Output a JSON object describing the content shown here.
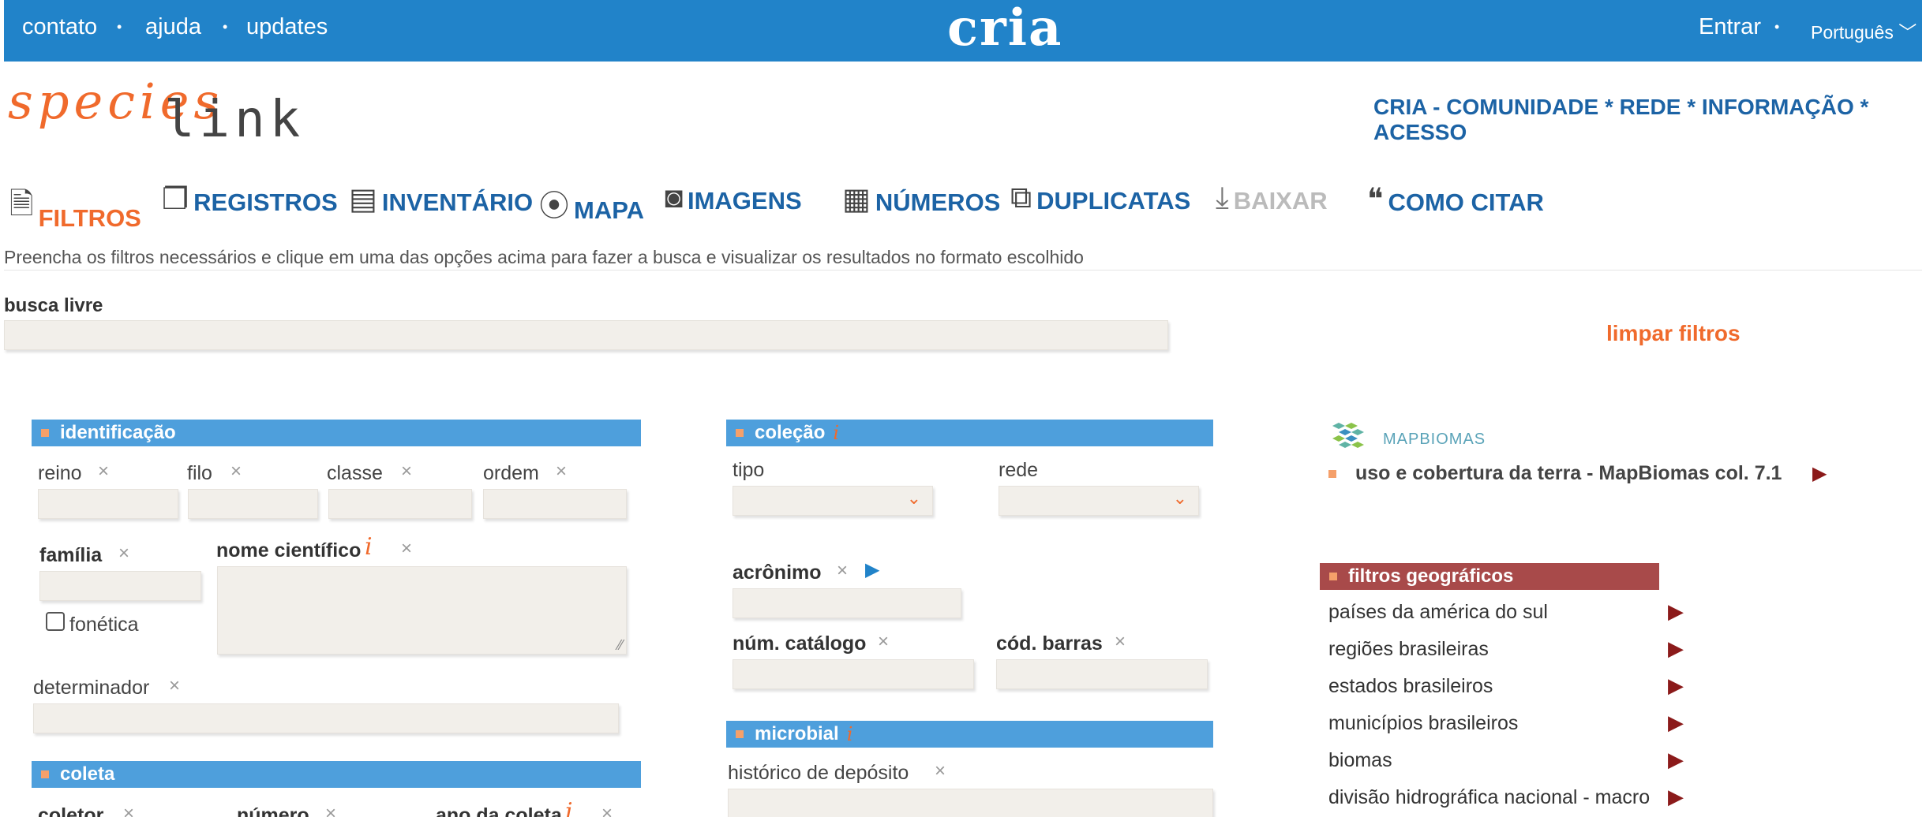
{
  "topbar": {
    "links": [
      "contato",
      "ajuda",
      "updates"
    ],
    "brand": "cria",
    "login": "Entrar",
    "language": "Português"
  },
  "logo": {
    "species": "species",
    "link": "link"
  },
  "tagline": "CRIA - COMUNIDADE * REDE * INFORMAÇÃO * ACESSO",
  "nav": {
    "filtros": "FILTROS",
    "registros": "REGISTROS",
    "inventario": "INVENTÁRIO",
    "mapa": "MAPA",
    "imagens": "IMAGENS",
    "numeros": "NÚMEROS",
    "duplicatas": "DUPLICATAS",
    "baixar": "BAIXAR",
    "como_citar": "COMO CITAR"
  },
  "hint": "Preencha os filtros necessários e clique em uma das opções acima para fazer a busca e visualizar os resultados no formato escolhido",
  "busca_livre": "busca livre",
  "limpar": "limpar filtros",
  "identificacao": {
    "title": "identificação",
    "reino": "reino",
    "filo": "filo",
    "classe": "classe",
    "ordem": "ordem",
    "familia": "família",
    "nome_cientifico": "nome científico",
    "fonetica": "fonética",
    "determinador": "determinador"
  },
  "coleta": {
    "title": "coleta",
    "coletor": "coletor",
    "numero": "número",
    "ano": "ano da coleta"
  },
  "colecao": {
    "title": "coleção",
    "tipo": "tipo",
    "rede": "rede",
    "acronimo": "acrônimo",
    "num_catalogo": "núm. catálogo",
    "cod_barras": "cód. barras"
  },
  "microbial": {
    "title": "microbial",
    "historico": "histórico de depósito"
  },
  "mapbiomas": {
    "logo_text": "MAPBIOMAS",
    "link": "uso e cobertura da terra - MapBiomas col. 7.1"
  },
  "geo": {
    "title": "filtros geográficos",
    "items": [
      "países da américa do sul",
      "regiões brasileiras",
      "estados brasileiros",
      "municípios brasileiros",
      "biomas",
      "divisão hidrográfica nacional - macro"
    ]
  },
  "symbols": {
    "x": "×",
    "info": "i",
    "arrow": "▶",
    "chevron": "⌄",
    "dot": "•"
  }
}
